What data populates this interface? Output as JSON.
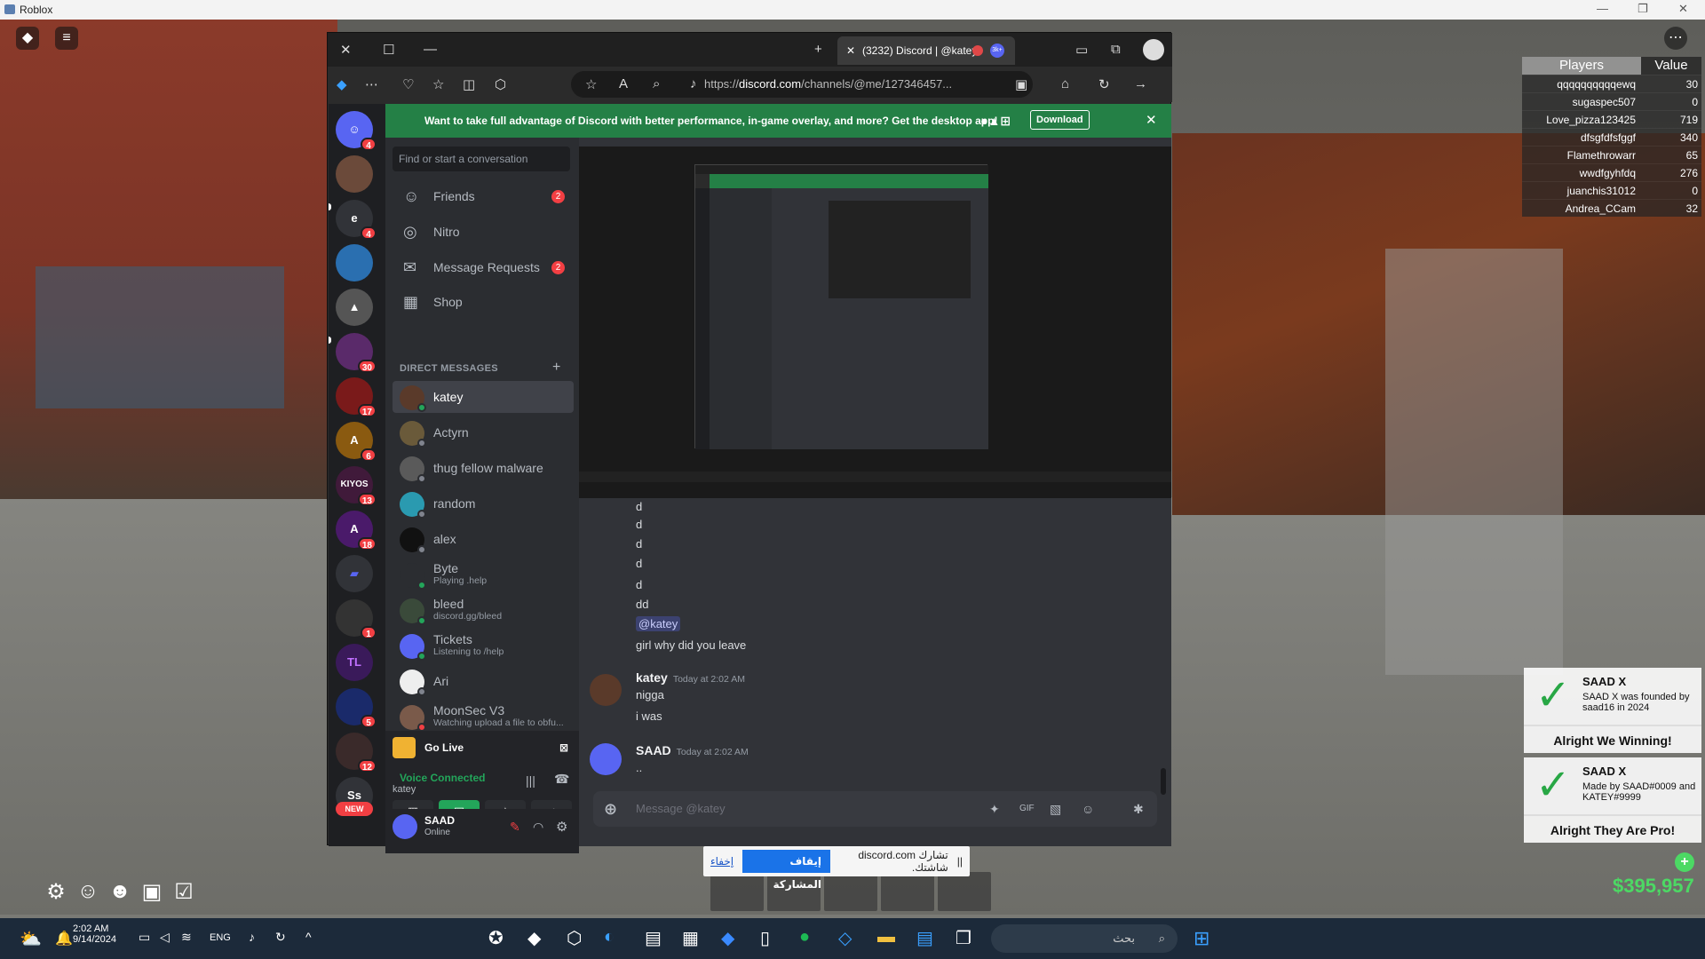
{
  "window": {
    "title": "Roblox"
  },
  "leaderboard": {
    "col_players": "Players",
    "col_value": "Value",
    "rows": [
      {
        "name": "qqqqqqqqqqewq",
        "value": "30"
      },
      {
        "name": "sugaspec507",
        "value": "0"
      },
      {
        "name": "Love_pizza123425",
        "value": "719"
      },
      {
        "name": "dfsgfdfsfggf",
        "value": "340"
      },
      {
        "name": "Flamethrowarr",
        "value": "65"
      },
      {
        "name": "wwdfgyhfdq",
        "value": "276"
      },
      {
        "name": "juanchis31012",
        "value": "0"
      },
      {
        "name": "Andrea_CCam",
        "value": "32"
      }
    ]
  },
  "notifications": [
    {
      "title": "SAAD X",
      "text": "SAAD X was founded by saad16 in 2024",
      "footer": "Alright We Winning!"
    },
    {
      "title": "SAAD X",
      "text": "Made by SAAD#0009 and KATEY#9999",
      "footer": "Alright They Are Pro!"
    }
  ],
  "money": "$395,957",
  "share_bar": {
    "text": "تشارك discord.com شاشتك.",
    "stop": "إيقاف المشاركة",
    "hide": "إخفاء"
  },
  "browser": {
    "tab_title": "(3232) Discord | @katey",
    "tab_badge": "3k+",
    "url_prefix": "https://",
    "url_domain": "discord.com",
    "url_rest": "/channels/@me/127346457..."
  },
  "discord": {
    "banner": {
      "text": "Want to take full advantage of Discord with better performance, in-game overlay, and more? Get the desktop app!",
      "download": "Download"
    },
    "search_placeholder": "Find or start a conversation",
    "nav": [
      {
        "label": "Friends",
        "badge": "2",
        "icon": "friends-icon"
      },
      {
        "label": "Nitro",
        "badge": "",
        "icon": "nitro-icon"
      },
      {
        "label": "Message Requests",
        "badge": "2",
        "icon": "mail-icon"
      },
      {
        "label": "Shop",
        "badge": "",
        "icon": "shop-icon"
      }
    ],
    "dm_header": "DIRECT MESSAGES",
    "dms": [
      {
        "name": "katey",
        "sub": "",
        "selected": true
      },
      {
        "name": "Actyrn",
        "sub": ""
      },
      {
        "name": "thug fellow malware",
        "sub": ""
      },
      {
        "name": "random",
        "sub": ""
      },
      {
        "name": "alex",
        "sub": ""
      },
      {
        "name": "Byte",
        "sub": "Playing .help"
      },
      {
        "name": "bleed",
        "sub": "discord.gg/bleed"
      },
      {
        "name": "Tickets",
        "sub": "Listening to /help"
      },
      {
        "name": "Ari",
        "sub": ""
      },
      {
        "name": "MoonSec V3",
        "sub": "Watching upload a file to obfu..."
      }
    ],
    "guild_badges": [
      "4",
      "4",
      "30",
      "17",
      "6",
      "13",
      "18",
      "1",
      "5",
      "12"
    ],
    "guild_labels": {
      "e": "e",
      "kiyos": "KIYOS",
      "tl": "TL",
      "ss": "Ss",
      "new": "NEW"
    },
    "go_live": "Go Live",
    "voice": {
      "status": "Voice Connected",
      "channel": "katey"
    },
    "user": {
      "name": "SAAD",
      "status": "Online"
    },
    "messages_plain": [
      "d",
      "d",
      "d",
      "d",
      "d",
      "dd"
    ],
    "mention": "@katey",
    "after_mention": "girl why did you leave",
    "msg1": {
      "author": "katey",
      "time": "Today at 2:02 AM",
      "lines": [
        "nigga",
        "i was"
      ]
    },
    "msg2": {
      "author": "SAAD",
      "time": "Today at 2:02 AM",
      "lines": [
        ".."
      ]
    },
    "input_placeholder": "Message @katey"
  },
  "taskbar": {
    "time": "2:02 AM",
    "date": "9/14/2024",
    "lang": "ENG",
    "search": "بحث"
  }
}
